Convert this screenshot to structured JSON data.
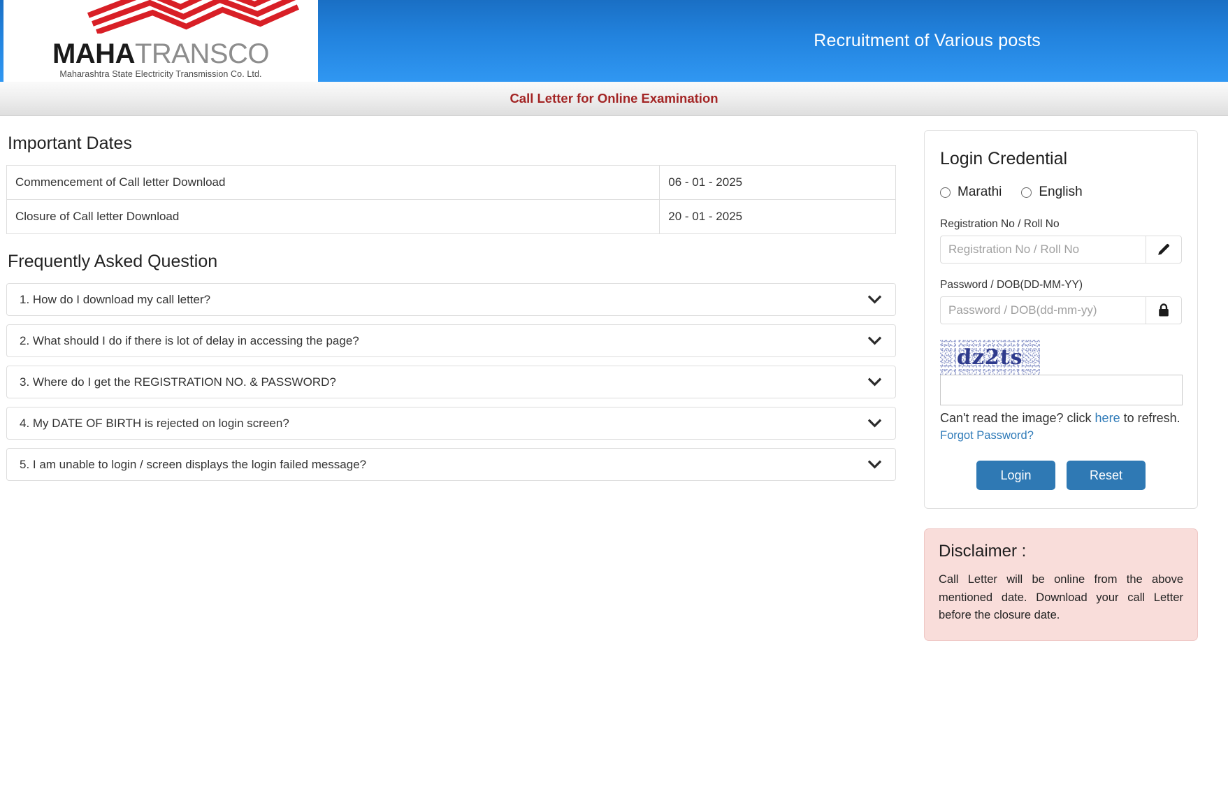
{
  "header": {
    "logo": {
      "brand_bold": "MAHA",
      "brand_light": "TRANSCO",
      "subtitle": "Maharashtra State Electricity Transmission Co. Ltd.",
      "wave_color": "#d81f26"
    },
    "title": "Recruitment of Various posts",
    "gradient_top": "#1a6fc4",
    "gradient_bottom": "#3097f2"
  },
  "subtitle_bar": {
    "text": "Call Letter for Online Examination",
    "text_color": "#a32525"
  },
  "important_dates": {
    "heading": "Important Dates",
    "rows": [
      {
        "label": "Commencement of Call letter Download",
        "value": "06 - 01 - 2025"
      },
      {
        "label": "Closure of Call letter Download",
        "value": "20 - 01 - 2025"
      }
    ]
  },
  "faq": {
    "heading": "Frequently Asked Question",
    "items": [
      {
        "question": "1. How do I download my call letter?"
      },
      {
        "question": "2. What should I do if there is lot of delay in accessing the page?"
      },
      {
        "question": "3. Where do I get the REGISTRATION NO. & PASSWORD?"
      },
      {
        "question": "4. My DATE OF BIRTH is rejected on login screen?"
      },
      {
        "question": "5. I am unable to login / screen displays the login failed message?"
      }
    ]
  },
  "login": {
    "title": "Login Credential",
    "languages": [
      {
        "label": "Marathi",
        "selected": false
      },
      {
        "label": "English",
        "selected": false
      }
    ],
    "registration": {
      "label": "Registration No / Roll No",
      "placeholder": "Registration No / Roll No",
      "value": "",
      "addon_icon": "pencil-icon"
    },
    "password": {
      "label": "Password / DOB(DD-MM-YY)",
      "placeholder": "Password / DOB(dd-mm-yy)",
      "value": "",
      "addon_icon": "lock-icon"
    },
    "captcha": {
      "text": "dz2ts",
      "value": "",
      "placeholder": "",
      "refresh_prefix": "Can't read the image? click ",
      "refresh_link": "here",
      "refresh_suffix": " to refresh.",
      "text_color": "#2e3a8c"
    },
    "forgot_password": "Forgot Password?",
    "buttons": {
      "login": "Login",
      "reset": "Reset",
      "color": "#2f79b4"
    },
    "link_color": "#2e7ab8"
  },
  "disclaimer": {
    "heading": "Disclaimer :",
    "body": "Call Letter will be online from the above mentioned date. Download your call Letter before the closure date.",
    "background": "#f9ddda",
    "border": "#eec7c5"
  }
}
